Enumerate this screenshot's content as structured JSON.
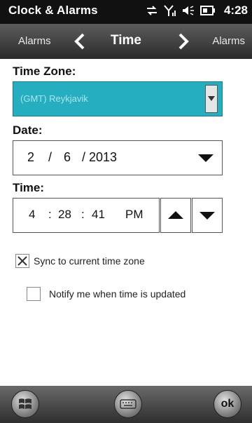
{
  "status_bar": {
    "title": "Clock & Alarms",
    "time": "4:28",
    "icons": [
      "data-transfer-icon",
      "signal-icon",
      "volume-icon",
      "battery-icon"
    ]
  },
  "nav": {
    "left_label": "Alarms",
    "title": "Time",
    "right_label": "Alarms"
  },
  "form": {
    "timezone_label": "Time Zone:",
    "timezone_value": "(GMT) Reykjavik",
    "date_label": "Date:",
    "date": {
      "month": "2",
      "sep1": "/",
      "day": "6",
      "sep2": "/",
      "year": "2013"
    },
    "time_label": "Time:",
    "time": {
      "hour": "4",
      "sep1": ":",
      "minute": "28",
      "sep2": ":",
      "second": "41",
      "ampm": "PM"
    },
    "sync_label": "Sync to current time zone",
    "sync_checked": true,
    "notify_label": "Notify me when time is updated",
    "notify_checked": false
  },
  "bottom_bar": {
    "ok_label": "ok",
    "icons": [
      "windows-start-icon",
      "keyboard-icon"
    ]
  },
  "colors": {
    "accent": "#25aebf",
    "status_bar": "#111111"
  }
}
